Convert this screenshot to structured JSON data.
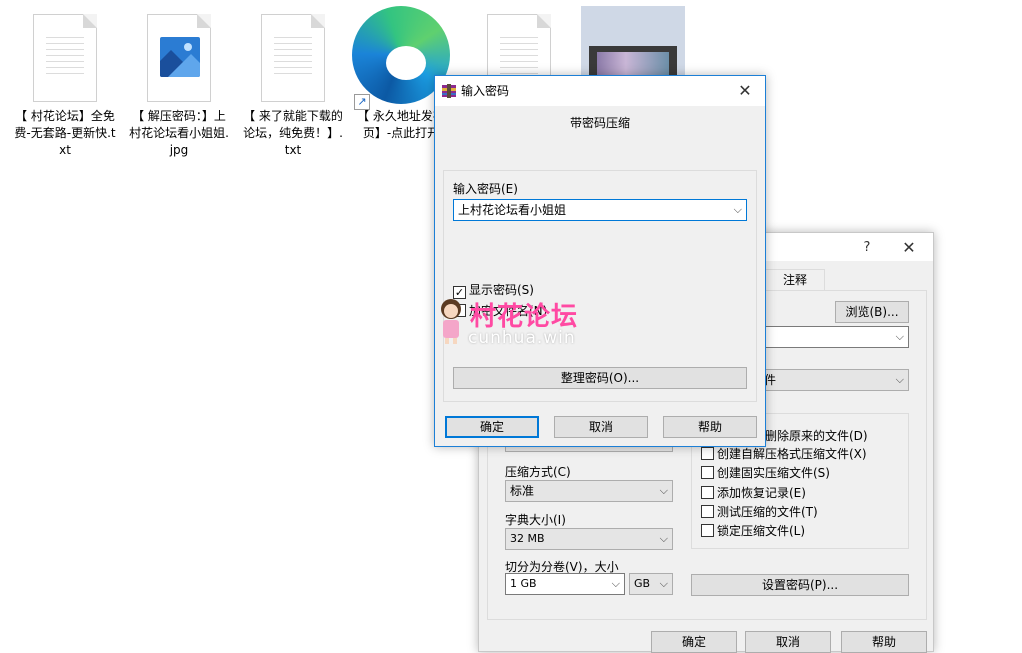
{
  "desktop": {
    "icons": [
      {
        "name": "txt",
        "label": "【 村花论坛】全免费-无套路-更新快.txt"
      },
      {
        "name": "jpg",
        "label": "【 解压密码：】上村花论坛看小姐姐.jpg"
      },
      {
        "name": "txt2",
        "label": "【 来了就能下载的论坛，纯免费！】.txt"
      },
      {
        "name": "edge",
        "label": "【 永久地址发布页】-点此打开"
      },
      {
        "name": "txt3",
        "label": ""
      },
      {
        "name": "video",
        "label": ""
      }
    ]
  },
  "back_dialog": {
    "help_icon": "?",
    "close_icon": "✕",
    "tab_comment": "注释",
    "browse_button": "浏览(B)...",
    "combo_top_value": "",
    "combo_mid_value": "件",
    "chk_delete_orig": "删除原来的文件(D)",
    "chk_sfx": "创建自解压格式压缩文件(X)",
    "chk_solid": "创建固实压缩文件(S)",
    "chk_recovery": "添加恢复记录(E)",
    "chk_test": "测试压缩的文件(T)",
    "chk_lock": "锁定压缩文件(L)",
    "compress_method_label": "压缩方式(C)",
    "compress_method_value": "标准",
    "dict_size_label": "字典大小(I)",
    "dict_size_value": "32 MB",
    "split_label": "切分为分卷(V)，大小",
    "split_value": "1 GB",
    "split_unit": "GB",
    "set_password_button": "设置密码(P)...",
    "ok_button": "确定",
    "cancel_button": "取消",
    "help_button": "帮助"
  },
  "pwd_dialog": {
    "title": "输入密码",
    "close_icon": "✕",
    "heading": "带密码压缩",
    "pwd_label": "输入密码(E)",
    "pwd_value": "上村花论坛看小姐姐",
    "show_pwd_label": "显示密码(S)",
    "show_pwd_checked": true,
    "encrypt_names_label": "加密文件名(N)",
    "encrypt_names_checked": false,
    "organize_button": "整理密码(O)...",
    "ok_button": "确定",
    "cancel_button": "取消",
    "help_button": "帮助"
  },
  "watermark": {
    "text": "村花论坛",
    "sub": "cunhua.win"
  },
  "colors": {
    "accent": "#0078d7",
    "border": "#1c7fd6",
    "watermark": "#ff4aa3"
  }
}
